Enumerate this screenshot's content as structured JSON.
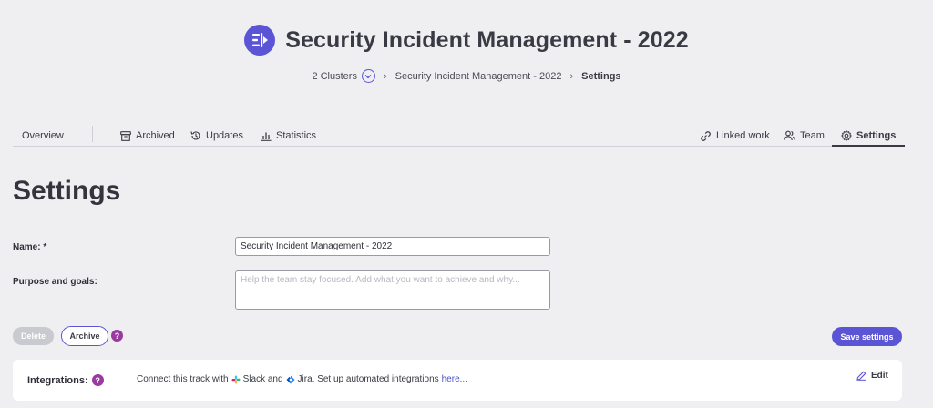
{
  "header": {
    "title": "Security Incident Management - 2022",
    "logo_icon": "track-icon",
    "accent_color": "#5b55d6"
  },
  "breadcrumb": {
    "clusters": "2 Clusters",
    "track": "Security Incident Management - 2022",
    "current": "Settings"
  },
  "tabs": {
    "overview": "Overview",
    "archived": "Archived",
    "updates": "Updates",
    "statistics": "Statistics",
    "linked_work": "Linked work",
    "team": "Team",
    "settings": "Settings"
  },
  "page": {
    "title": "Settings"
  },
  "form": {
    "name_label": "Name: *",
    "name_value": "Security Incident Management - 2022",
    "purpose_label": "Purpose and goals:",
    "purpose_placeholder": "Help the team stay focused. Add what you want to achieve and why..."
  },
  "actions": {
    "delete": "Delete",
    "archive": "Archive",
    "help": "?",
    "save": "Save settings"
  },
  "integrations": {
    "label": "Integrations:",
    "text_prefix": "Connect this track with",
    "slack": "Slack and",
    "jira": "Jira. Set up automated integrations",
    "link": "here...",
    "edit": "Edit"
  }
}
